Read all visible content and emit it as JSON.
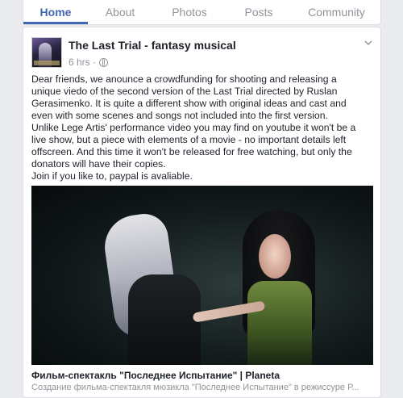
{
  "tabs": [
    {
      "label": "Home",
      "active": true
    },
    {
      "label": "About",
      "active": false
    },
    {
      "label": "Photos",
      "active": false
    },
    {
      "label": "Posts",
      "active": false
    },
    {
      "label": "Community",
      "active": false
    }
  ],
  "post": {
    "page_name": "The Last Trial - fantasy musical",
    "time": "6 hrs ·",
    "privacy_icon": "globe-icon",
    "text": "Dear friends, we anounce a crowdfunding for shooting and releasing a\nunique viedo of the second version of the Last Trial directed by Ruslan\nGerasimenko. It is quite a different show with original ideas and cast and\neven with some scenes and songs not included into the first version.\nUnlike Lege Artis' performance video you may find on youtube it won't be a\nlive show, but a piece with elements of a movie - no important details left\noffscreen. And this time it won't be released for free watching, but only the\ndonators will have their copies.\nJoin if you like to, paypal is avaliable.",
    "link": {
      "title": "Фильм-спектакль \"Последнее Испытание\" | Planeta",
      "description": "Создание фильма-спектакля мюзикла \"Последнее Испытание\" в режиссуре Р..."
    }
  },
  "colors": {
    "accent": "#4267b2",
    "muted": "#90949c",
    "text": "#1d2129",
    "background": "#e9ebee"
  }
}
